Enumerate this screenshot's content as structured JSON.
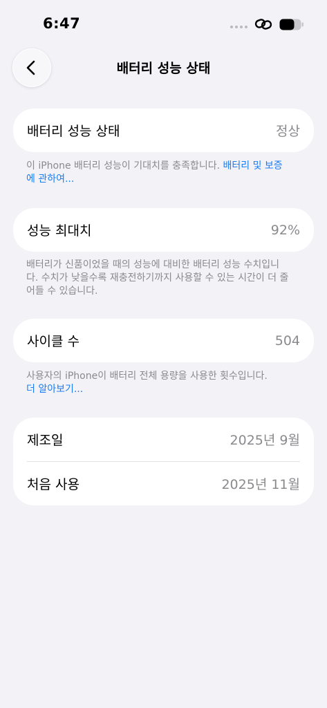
{
  "status_bar": {
    "time": "6:47"
  },
  "nav": {
    "title": "배터리 성능 상태"
  },
  "health": {
    "label": "배터리 성능 상태",
    "value": "정상",
    "footnote": "이 iPhone 배터리 성능이 기대치를 충족합니다. ",
    "footnote_link": "배터리 및 보증에 관하여..."
  },
  "max_capacity": {
    "label": "성능 최대치",
    "value": "92%",
    "footnote": "배터리가 신품이었을 때의 성능에 대비한 배터리 성능 수치입니다. 수치가 낮을수록 재충전하기까지 사용할 수 있는 시간이 더 줄어들 수 있습니다."
  },
  "cycle_count": {
    "label": "사이클 수",
    "value": "504",
    "footnote": "사용자의 iPhone이 배터리 전체 용량을 사용한 횟수입니다.",
    "footnote_link": "더 알아보기..."
  },
  "dates": {
    "manufacture_label": "제조일",
    "manufacture_value": "2025년 9월",
    "first_use_label": "처음 사용",
    "first_use_value": "2025년 11월"
  },
  "colors": {
    "background": "#f2f2f7",
    "link": "#1c7cf2",
    "secondary_text": "#8a8a8e"
  }
}
